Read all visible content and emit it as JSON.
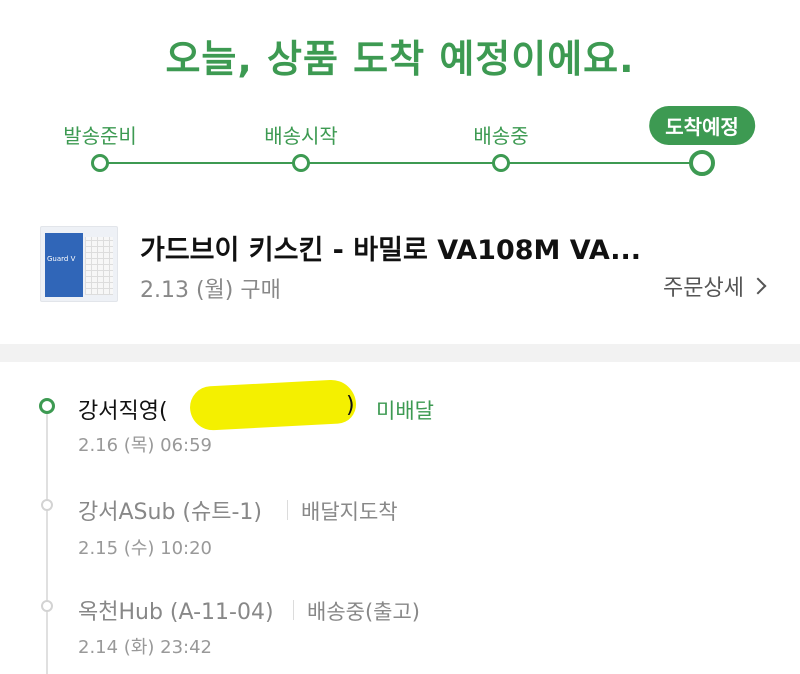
{
  "colors": {
    "accent": "#3d9a52",
    "text": "#111111",
    "muted": "#888888"
  },
  "headline": "오늘, 상품 도착 예정이에요.",
  "steps": [
    {
      "label": "발송준비",
      "state": "done"
    },
    {
      "label": "배송시작",
      "state": "done"
    },
    {
      "label": "배송중",
      "state": "done"
    },
    {
      "label": "도착예정",
      "state": "current"
    }
  ],
  "product": {
    "title": "가드브이 키스킨 - 바밀로 VA108M VA...",
    "purchase_date": "2.13 (월) 구매",
    "detail_link": "주문상세",
    "thumbnail_brand": "Guard V"
  },
  "timeline": [
    {
      "location": "강서직영(",
      "location_tail": ")",
      "status": "미배달",
      "time": "2.16 (목) 06:59",
      "active": true,
      "redacted": true
    },
    {
      "location": "강서ASub (슈트-1)",
      "status": "배달지도착",
      "time": "2.15 (수) 10:20",
      "active": false
    },
    {
      "location": "옥천Hub (A-11-04)",
      "status": "배송중(출고)",
      "time": "2.14 (화) 23:42",
      "active": false
    }
  ]
}
